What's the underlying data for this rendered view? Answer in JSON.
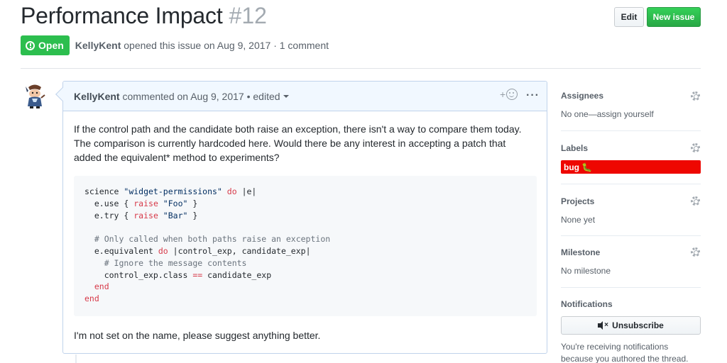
{
  "issue": {
    "title": "Performance Impact",
    "number": "#12",
    "state": "Open",
    "author": "KellyKent",
    "opened_text": "opened this issue on Aug 9, 2017 · 1 comment"
  },
  "header": {
    "edit_label": "Edit",
    "new_issue_label": "New issue"
  },
  "comment": {
    "author": "KellyKent",
    "meta": "commented on Aug 9, 2017 • edited",
    "reaction_plus": "+",
    "more": "···",
    "paragraph": "If the control path and the candidate both raise an exception, there isn't a way to compare them today. The comparison is currently hardcoded here. Would there be any interest in accepting a patch that added the equivalent* method to experiments?",
    "code": {
      "l1a": "science ",
      "l1s": "\"widget-permissions\"",
      "l1k": " do",
      "l1b": " |e|",
      "l2a": "  e.use { ",
      "l2k": "raise",
      "l2s": " \"Foo\"",
      "l2b": " }",
      "l3a": "  e.try { ",
      "l3k": "raise",
      "l3s": " \"Bar\"",
      "l3b": " }",
      "l5": "  # Only called when both paths raise an exception",
      "l6a": "  e.equivalent ",
      "l6k": "do",
      "l6b": " |control_exp, candidate_exp|",
      "l7": "    # Ignore the message contents",
      "l8a": "    control_exp.class ",
      "l8k": "==",
      "l8b": " candidate_exp",
      "l9": "  end",
      "l10": "end"
    },
    "closing": "I'm not set on the name, please suggest anything better."
  },
  "sidebar": {
    "assignees": {
      "heading": "Assignees",
      "value": "No one—assign yourself"
    },
    "labels": {
      "heading": "Labels",
      "bug": "bug 🐛",
      "bug_color": "#ee0701"
    },
    "projects": {
      "heading": "Projects",
      "value": "None yet"
    },
    "milestone": {
      "heading": "Milestone",
      "value": "No milestone"
    },
    "notifications": {
      "heading": "Notifications",
      "button": "Unsubscribe",
      "text": "You're receiving notifications because you authored the thread."
    }
  },
  "colors": {
    "open_green": "#2cbe4e",
    "primary_button": "#28a745",
    "comment_header_bg": "#f1f8ff"
  }
}
